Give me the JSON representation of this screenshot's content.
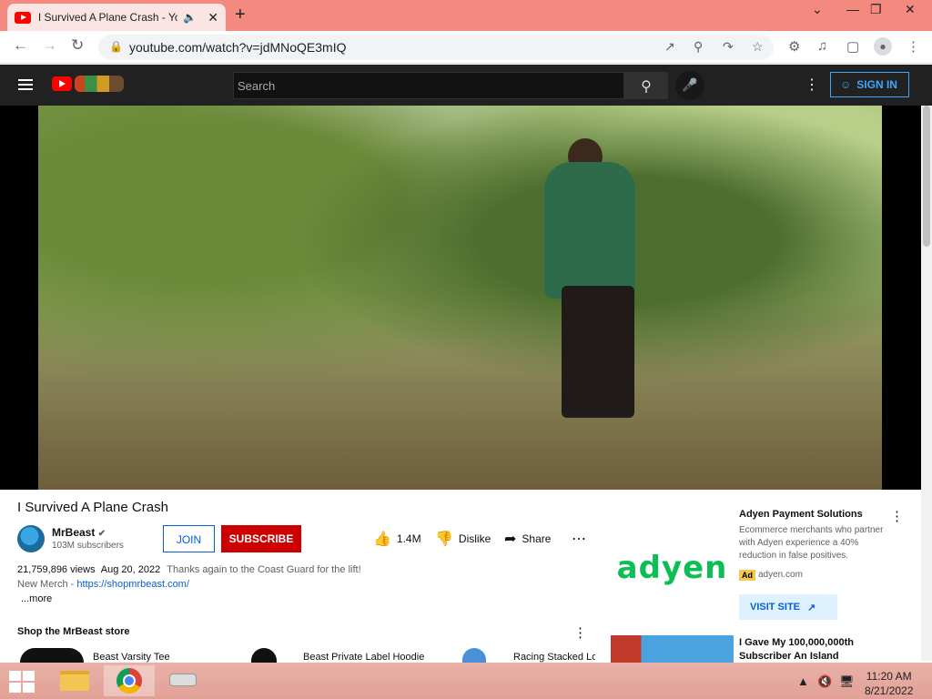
{
  "browser": {
    "tab_title": "I Survived A Plane Crash - YouTube",
    "tab_audio_icon": "speaker-icon",
    "new_tab": "+",
    "url": "youtube.com/watch?v=jdMNoQE3mIQ"
  },
  "youtube": {
    "search_placeholder": "Search",
    "sign_in": "SIGN IN"
  },
  "video": {
    "title": "I Survived A Plane Crash",
    "channel": "MrBeast",
    "subscribers": "103M subscribers",
    "join": "JOIN",
    "subscribe": "SUBSCRIBE",
    "likes": "1.4M",
    "dislike": "Dislike",
    "share": "Share",
    "views": "21,759,896 views",
    "date": "Aug 20, 2022",
    "description": "Thanks again to the Coast Guard for the lift!",
    "merch_label": "New Merch - ",
    "merch_link": "https://shopmrbeast.com/",
    "more": "...more"
  },
  "store": {
    "title": "Shop the MrBeast store",
    "products": [
      "Beast Varsity Tee",
      "Beast Private Label Hoodie",
      "Racing Stacked Lo"
    ]
  },
  "ad": {
    "brand_logo": "adyen",
    "title": "Adyen Payment Solutions",
    "text": "Ecommerce merchants who partner with Adyen experience a 40% reduction in false positives.",
    "badge": "Ad",
    "domain": "adyen.com",
    "cta": "VISIT SITE"
  },
  "recommendation": {
    "title": "I Gave My 100,000,000th Subscriber An Island"
  },
  "taskbar": {
    "time": "11:20 AM",
    "date": "8/21/2022"
  }
}
